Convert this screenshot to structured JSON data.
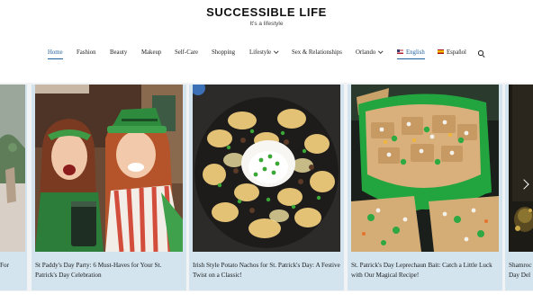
{
  "site": {
    "title": "SUCCESSIBLE LIFE",
    "tagline": "It's a lifestyle"
  },
  "nav": {
    "items": [
      {
        "label": "Home",
        "active": true
      },
      {
        "label": "Fashion"
      },
      {
        "label": "Beauty"
      },
      {
        "label": "Makeup"
      },
      {
        "label": "Self-Care"
      },
      {
        "label": "Shopping"
      },
      {
        "label": "Lifestyle",
        "dropdown": true
      },
      {
        "label": "Sex & Relationships"
      },
      {
        "label": "Orlando",
        "dropdown": true
      },
      {
        "label": "English",
        "flag": "us",
        "active": true
      },
      {
        "label": "Español",
        "flag": "es"
      }
    ],
    "search_icon": "search-icon"
  },
  "slider": {
    "cards": [
      {
        "caption": "For"
      },
      {
        "caption": "St Paddy's Day Party: 6 Must-Haves for Your St. Patrick's Day Celebration"
      },
      {
        "caption": "Irish Style Potato Nachos for St. Patrick's Day: A Festive Twist on a Classic!"
      },
      {
        "caption": "St. Patrick's Day Leprechaun Bait: Catch a Little Luck with Our Magical Recipe!"
      },
      {
        "caption": "Shamroc Day Del"
      }
    ],
    "next_icon": "chevron-right-icon"
  },
  "colors": {
    "accent": "#1f5f9c",
    "card_bg": "#d3e4ef"
  }
}
